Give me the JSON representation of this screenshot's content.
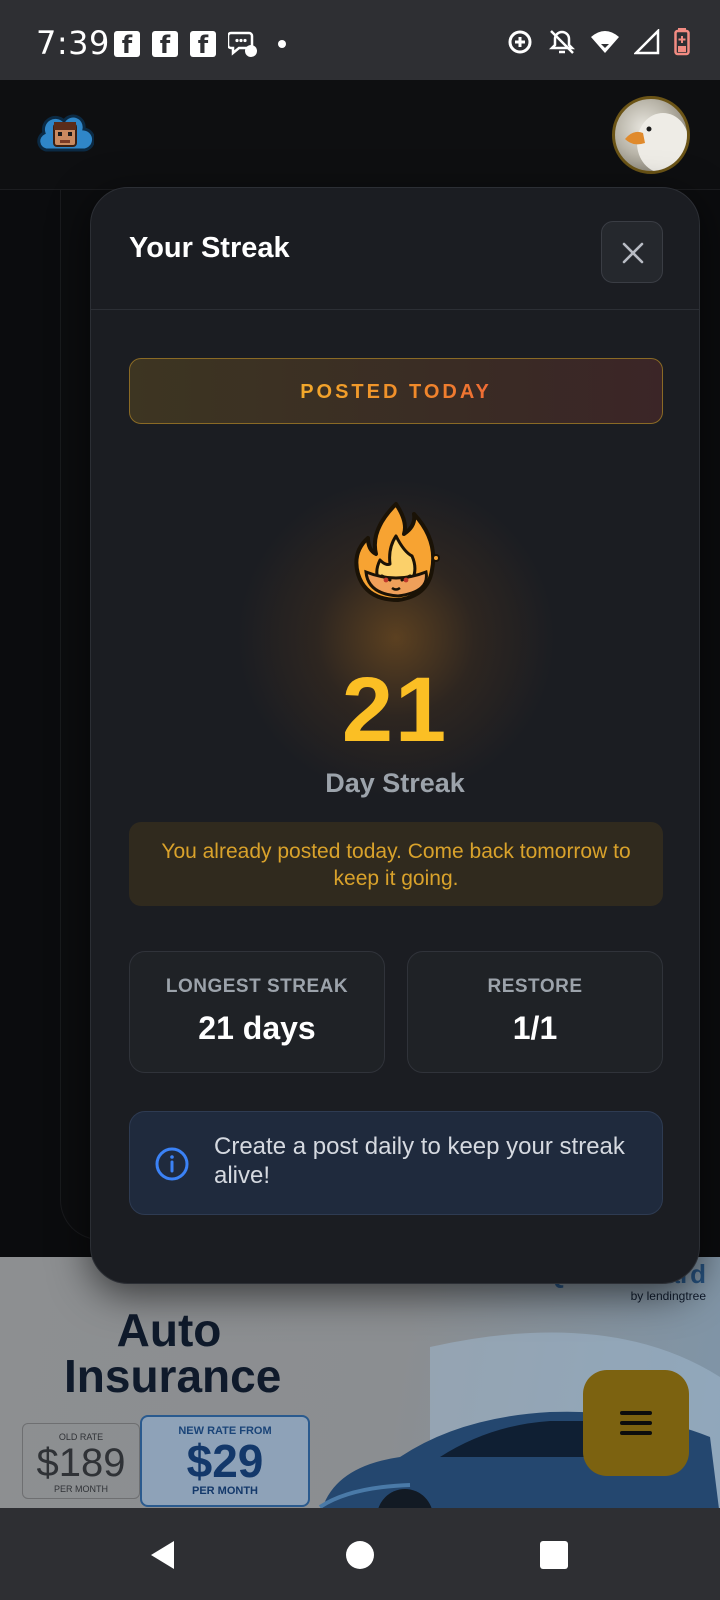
{
  "status_bar": {
    "time": "7:39",
    "notification_icons": [
      "facebook-icon",
      "facebook-icon",
      "facebook-icon",
      "messenger-icon"
    ],
    "system_icons": [
      "data-saver-icon",
      "notifications-off-icon",
      "wifi-icon",
      "signal-icon",
      "battery-low-icon"
    ]
  },
  "header": {
    "logo": "app-logo",
    "avatar": "goose-avatar"
  },
  "modal": {
    "title": "Your Streak",
    "close_icon": "close-icon",
    "badge": "POSTED TODAY",
    "streak_icon": "flame-icon",
    "streak_count": "21",
    "streak_label": "Day Streak",
    "notice": "You already posted today. Come back tomorrow to keep it going.",
    "stats": [
      {
        "label": "LONGEST STREAK",
        "value": "21 days"
      },
      {
        "label": "RESTORE",
        "value": "1/1"
      }
    ],
    "info_icon": "info-icon",
    "info_text": "Create a post daily to keep your streak alive!"
  },
  "ad": {
    "title": "Auto Insurance",
    "brand": "QuoteWizard",
    "brand_sub": "by lendingtree",
    "old_rate_label": "OLD RATE",
    "old_rate_price": "$189",
    "old_rate_unit": "PER MONTH",
    "new_rate_label": "NEW RATE FROM",
    "new_rate_price": "$29",
    "new_rate_unit": "PER MONTH"
  },
  "fab": {
    "icon": "menu-icon"
  },
  "nav_bar": {
    "buttons": [
      "back-icon",
      "home-icon",
      "recents-icon"
    ]
  },
  "colors": {
    "accent": "#fbbf24",
    "modal_bg": "#1b1d22",
    "badge_text_start": "#f2a92b",
    "badge_text_end": "#ef6a35",
    "info_blue": "#3b82f6",
    "fab_bg": "#7c6210"
  }
}
